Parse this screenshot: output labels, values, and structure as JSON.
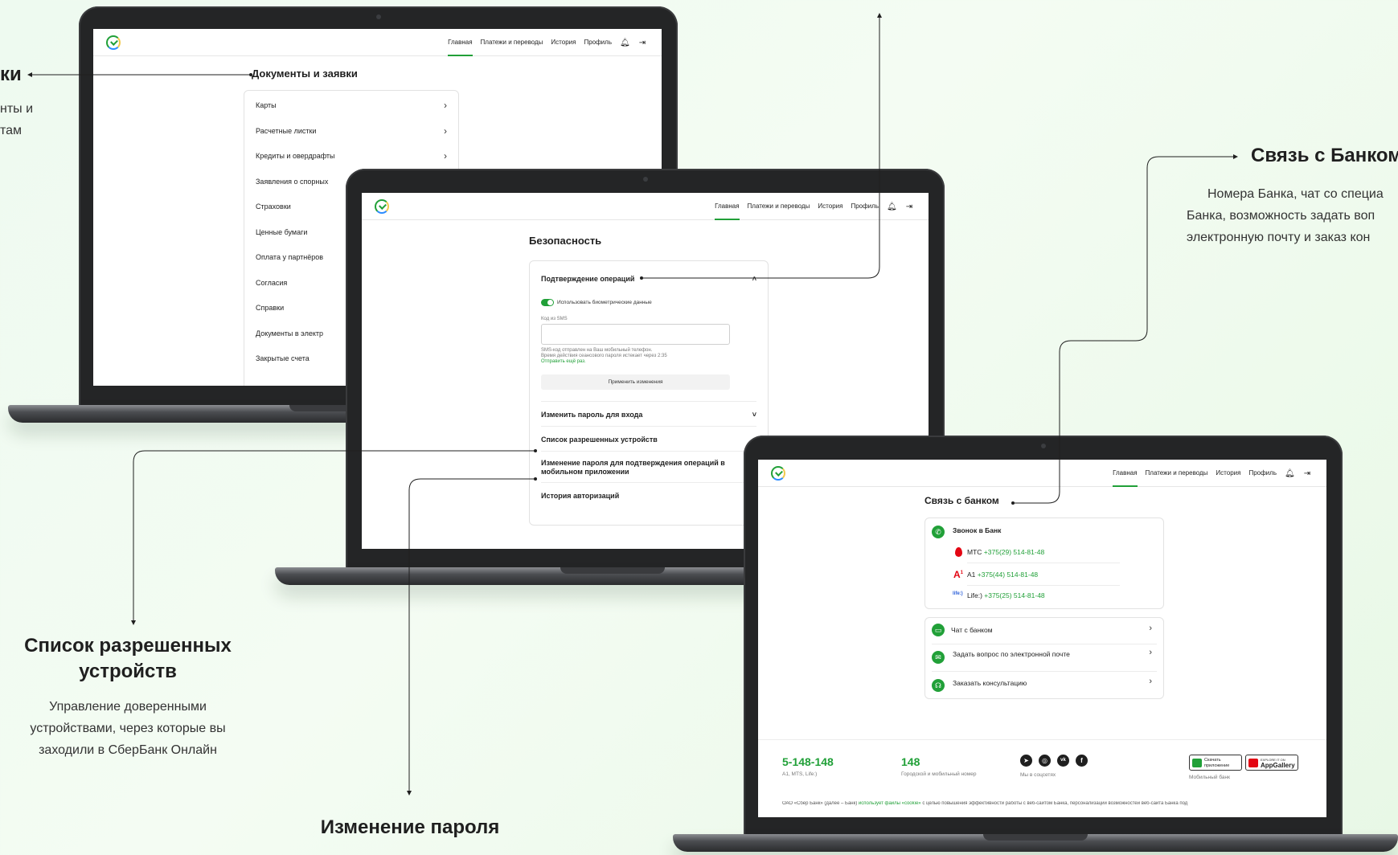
{
  "nav": {
    "items": [
      "Главная",
      "Платежи и переводы",
      "История",
      "Профиль"
    ],
    "bell_icon": "bell-icon",
    "logout_icon": "logout-icon"
  },
  "documents": {
    "title": "Документы и заявки",
    "items": [
      "Карты",
      "Расчетные листки",
      "Кредиты и овердрафты",
      "Заявления о спорных",
      "Страховки",
      "Ценные бумаги",
      "Оплата у партнёров",
      "Согласия",
      "Справки",
      "Документы в электр",
      "Закрытые счета"
    ]
  },
  "security": {
    "title": "Безопасность",
    "confirm_ops": "Подтверждение операций",
    "biometric": "Использовать биометрические данные",
    "sms_label": "Код из SMS",
    "sms_note_1": "SMS-код отправлен на Ваш мобильный телефон.",
    "sms_note_2": "Время действия сеансового пароля истекает через 2:35",
    "resend": "Отправить ещё раз.",
    "apply": "Применить изменения",
    "change_login_password": "Изменить пароль для входа",
    "allowed_devices": "Список разрешенных устройств",
    "change_mobile_password": "Изменение пароля для подтверждения операций в мобильном приложении",
    "auth_history": "История авторизаций"
  },
  "contact": {
    "title": "Связь с банком",
    "call_bank": "Звонок в Банк",
    "operators": [
      {
        "name": "МТС",
        "phone": "+375(29) 514-81-48"
      },
      {
        "name": "А1",
        "phone": "+375(44) 514-81-48"
      },
      {
        "name": "Life:)",
        "phone": "+375(25) 514-81-48"
      }
    ],
    "chat": "Чат с банком",
    "email": "Задать вопрос по электронной почте",
    "consult": "Заказать консультацию"
  },
  "footer": {
    "short_number": "5-148-148",
    "short_number_note": "A1, MTS, Life:)",
    "city_number": "148",
    "city_number_note": "Городской и мобильный номер",
    "social_note": "Мы в соцсетях",
    "store_1": "Скачать приложение",
    "store_2_top": "EXPLORE IT ON",
    "store_2": "AppGallery",
    "mobile_bank": "Мобильный банк",
    "legal_prefix": "ОАО «Сбер Банк» (далее – Банк)",
    "legal_link": "использует файлы «cookie»",
    "legal_rest": "с целью повышения эффективности работы с веб-сайтом Банка, персонализации возможностей веб-сайта Банка под"
  },
  "annotations": {
    "docs_title": "ки",
    "docs_desc_1": "нты и",
    "docs_desc_2": "там",
    "contact_title": "Связь с Банком",
    "contact_desc_1": "Номера Банка, чат со специа",
    "contact_desc_2": "Банка, возможность задать воп",
    "contact_desc_3": "электронную почту и заказ кон",
    "devices_title_1": "Список разрешенных",
    "devices_title_2": "устройств",
    "devices_desc_1": "Управление доверенными",
    "devices_desc_2": "устройствами, через которые вы",
    "devices_desc_3": "заходили в СберБанк Онлайн",
    "password_title": "Изменение пароля"
  },
  "colors": {
    "accent": "#21a038",
    "background": "#eefaf0",
    "laptop": "#242526"
  }
}
